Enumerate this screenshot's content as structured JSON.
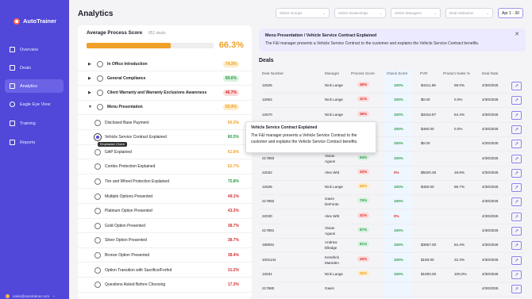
{
  "app": {
    "name": "AutoTrainer"
  },
  "sidebar": {
    "items": [
      {
        "label": "Overview",
        "icon": "grid-icon"
      },
      {
        "label": "Deals",
        "icon": "document-icon"
      },
      {
        "label": "Analytics",
        "icon": "chart-icon",
        "active": true
      },
      {
        "label": "Eagle Eye View",
        "icon": "eye-icon"
      },
      {
        "label": "Training",
        "icon": "graduation-icon"
      },
      {
        "label": "Reports",
        "icon": "report-icon"
      }
    ],
    "user_email": "sales@autotrainer.com"
  },
  "header": {
    "title": "Analytics",
    "filters": [
      "Select Groups",
      "Select Dealerships",
      "Select Managers",
      "Deal Attribution"
    ],
    "date_range": "Apr 1 - 30"
  },
  "process_card": {
    "title": "Average Process Score",
    "count": "851 deals",
    "score": "66.3%",
    "score_value": 0.663,
    "sections": [
      {
        "label": "In Office Introduction",
        "pct": "74.3%",
        "expanded": false
      },
      {
        "label": "General Compliance",
        "pct": "89.6%",
        "expanded": false
      },
      {
        "label": "Client Warranty and Warranty Exclusions Awareness",
        "pct": "46.7%",
        "expanded": false
      },
      {
        "label": "Menu Presentation",
        "pct": "50.4%",
        "expanded": true
      }
    ],
    "subitems": [
      {
        "label": "Disclosed Base Payment",
        "pct": "50.3%",
        "checked": false
      },
      {
        "label": "Vehicle Service Contract Explained",
        "pct": "80.5%",
        "checked": true
      },
      {
        "label": "GAP Explained",
        "pct": "61.6%",
        "checked": false
      },
      {
        "label": "Combo Protection Explained",
        "pct": "62.7%",
        "checked": false
      },
      {
        "label": "Tire and Wheel Protection Explained",
        "pct": "75.8%",
        "checked": false
      },
      {
        "label": "Multiple Options Presented",
        "pct": "49.1%",
        "checked": false
      },
      {
        "label": "Platinum Option Presented",
        "pct": "43.3%",
        "checked": false
      },
      {
        "label": "Gold Option Presented",
        "pct": "38.7%",
        "checked": false
      },
      {
        "label": "Silver Option Presented",
        "pct": "38.7%",
        "checked": false
      },
      {
        "label": "Bronze Option Presented",
        "pct": "38.4%",
        "checked": false
      },
      {
        "label": "Option Transition with Sacrifice/Forfeit",
        "pct": "31.2%",
        "checked": false
      },
      {
        "label": "Questions Asked Before Choosing",
        "pct": "17.3%",
        "checked": false
      }
    ],
    "tooltip": "Emphasize Check"
  },
  "info_banner": {
    "title": "Menu Presentation / Vehicle Service Contract Explained",
    "body": "The F&I manager presents a Vehicle Service Contract to the customer and explains the Vehicle Service Contract benefits."
  },
  "popover": {
    "title": "Vehicle Service Contract Explained",
    "body": "The F&I manager presents a Vehicle Service Contract to the customer and explains the Vehicle Service Contract benefits."
  },
  "deals": {
    "title": "Deals",
    "columns": [
      "Deal Number",
      "Manager",
      "Process Score",
      "Check Score",
      "PVR",
      "Product Sales %",
      "Deal Date"
    ],
    "rows": [
      {
        "deal": "12625",
        "manager": [
          "Nick Lange"
        ],
        "process": "45%",
        "check": "100%",
        "pvr": "$4411.69",
        "sales": "69.0%",
        "date": "4/30/2025"
      },
      {
        "deal": "12602",
        "manager": [
          "Nick Lange"
        ],
        "process": "41%",
        "check": "100%",
        "pvr": "$0.00",
        "sales": "0.0%",
        "date": "4/30/2025"
      },
      {
        "deal": "12570",
        "manager": [
          "Nick Lange"
        ],
        "process": "36%",
        "check": "100%",
        "pvr": "$3315.87",
        "sales": "54.4%",
        "date": "4/30/2025"
      },
      {
        "deal": "",
        "manager": [
          ""
        ],
        "process": "",
        "check": "100%",
        "pvr": "$450.00",
        "sales": "0.0%",
        "date": "4/30/2025"
      },
      {
        "deal": "",
        "manager": [
          ""
        ],
        "process": "",
        "check": "100%",
        "pvr": "$0.00",
        "sales": "",
        "date": "4/30/2025"
      },
      {
        "deal": "217883",
        "manager": [
          "Vivian",
          "Aguon"
        ],
        "process": "94%",
        "check": "100%",
        "pvr": "",
        "sales": "",
        "date": "4/30/2025"
      },
      {
        "deal": "22032",
        "manager": [
          "Alex Witt"
        ],
        "process": "32%",
        "check": "0%",
        "pvr": "$5020.36",
        "sales": "19.8%",
        "date": "4/30/2025"
      },
      {
        "deal": "12635",
        "manager": [
          "Nick Lange"
        ],
        "process": "69%",
        "check": "100%",
        "pvr": "$450.00",
        "sales": "66.7%",
        "date": "4/30/2025"
      },
      {
        "deal": "217882",
        "manager": [
          "Gavin",
          "DeFonte"
        ],
        "process": "75%",
        "check": "100%",
        "pvr": "",
        "sales": "",
        "date": "4/30/2025"
      },
      {
        "deal": "22030",
        "manager": [
          "Alex Witt"
        ],
        "process": "31%",
        "check": "0%",
        "pvr": "",
        "sales": "",
        "date": "4/30/2025"
      },
      {
        "deal": "217881",
        "manager": [
          "Vivian",
          "Aguon"
        ],
        "process": "87%",
        "check": "100%",
        "pvr": "",
        "sales": "",
        "date": "4/30/2025"
      },
      {
        "deal": "198091",
        "manager": [
          "Andrew",
          "Elledge"
        ],
        "process": "81%",
        "check": "100%",
        "pvr": "$3867.00",
        "sales": "54.4%",
        "date": "4/30/2025"
      },
      {
        "deal": "1001144",
        "manager": [
          "Kendrick",
          "Marsden"
        ],
        "process": "26%",
        "check": "100%",
        "pvr": "$193.00",
        "sales": "22.3%",
        "date": "4/30/2025"
      },
      {
        "deal": "12631",
        "manager": [
          "Nick Lange"
        ],
        "process": "55%",
        "check": "100%",
        "pvr": "$1000.00",
        "sales": "100.0%",
        "date": "4/30/2025"
      },
      {
        "deal": "217880",
        "manager": [
          "Gavin"
        ],
        "process": "",
        "check": "",
        "pvr": "",
        "sales": "",
        "date": "4/30/2025"
      }
    ]
  },
  "colors": {
    "primary": "#5147d9",
    "accent": "#f0a028",
    "good": "#2e9e4a",
    "warn": "#f0a028",
    "bad": "#d93030"
  }
}
